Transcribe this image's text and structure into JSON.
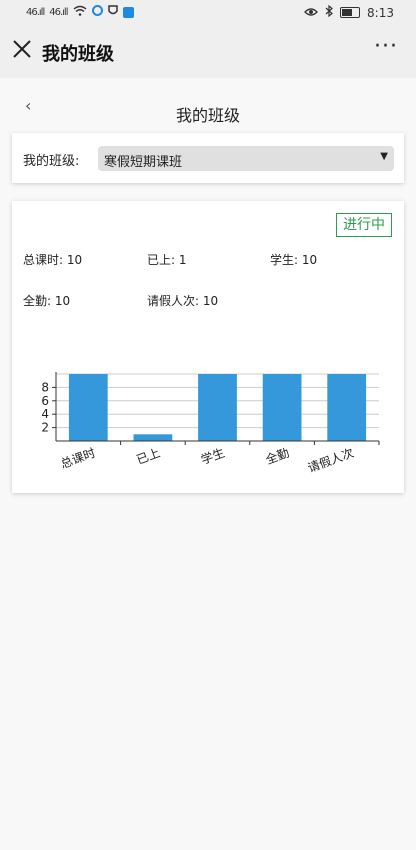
{
  "status_bar": {
    "signal1": "46.ıll",
    "signal2": "46.ıll",
    "time": "8:13"
  },
  "title_bar": {
    "title": "我的班级",
    "more": "···"
  },
  "page": {
    "back": "‹",
    "title": "我的班级"
  },
  "class_select": {
    "label": "我的班级:",
    "value": "寒假短期课班"
  },
  "stats_card": {
    "status_badge": "进行中",
    "stats": [
      {
        "label": "总课时:",
        "value": "10"
      },
      {
        "label": "已上:",
        "value": "1"
      },
      {
        "label": "学生:",
        "value": "10"
      },
      {
        "label": "全勤:",
        "value": "10"
      },
      {
        "label": "请假人次:",
        "value": "10"
      }
    ]
  },
  "chart_data": {
    "type": "bar",
    "categories": [
      "总课时",
      "已上",
      "学生",
      "全勤",
      "请假人次"
    ],
    "values": [
      10,
      1,
      10,
      10,
      10
    ],
    "ylim": [
      0,
      10
    ],
    "yticks": [
      2,
      4,
      6,
      8
    ],
    "grid": true,
    "color": "#3498db"
  }
}
